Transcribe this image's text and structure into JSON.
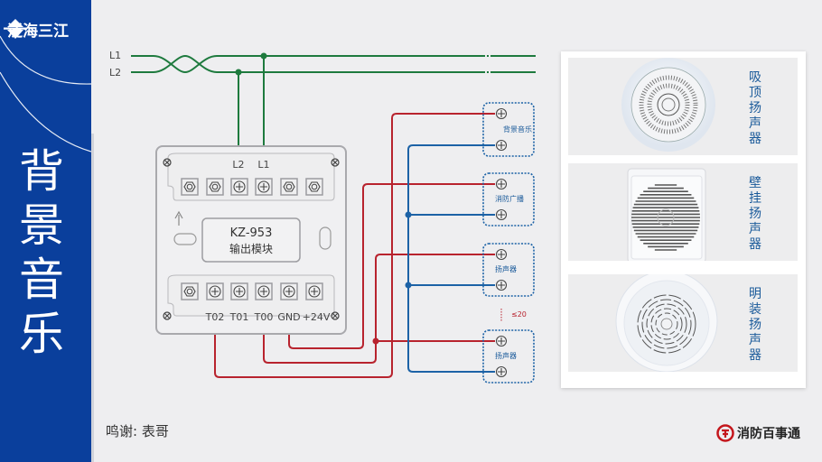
{
  "brand": {
    "name": "泛海三江",
    "logo_icon": "diamond-logo-icon"
  },
  "page_title": {
    "chars": [
      "背",
      "景",
      "音",
      "乐"
    ],
    "text": "背景音乐"
  },
  "colors": {
    "sidebar": "#0a3f9c",
    "power_line": "#1e7a3e",
    "signal_red": "#b8232e",
    "signal_blue": "#1c62a6",
    "speaker_box": "#1c62a6"
  },
  "power_lines": {
    "l1": "L1",
    "l2": "L2"
  },
  "module": {
    "model": "KZ-953",
    "name": "输出模块",
    "top_terminals": [
      "",
      "",
      "L2",
      "L1",
      "",
      ""
    ],
    "bottom_terminals": [
      "",
      "T02",
      "T01",
      "T00",
      "GND",
      "+24V"
    ]
  },
  "speakers": [
    {
      "label": "背景音乐"
    },
    {
      "label": "消防广播"
    },
    {
      "label": "扬声器"
    },
    {
      "label": "扬声器"
    }
  ],
  "spacing_note": "≤20",
  "products": [
    {
      "label_chars": [
        "吸",
        "顶",
        "扬",
        "声",
        "器"
      ],
      "label": "吸顶扬声器"
    },
    {
      "label_chars": [
        "壁",
        "挂",
        "扬",
        "声",
        "器"
      ],
      "label": "壁挂扬声器"
    },
    {
      "label_chars": [
        "明",
        "装",
        "扬",
        "声",
        "器"
      ],
      "label": "明装扬声器"
    }
  ],
  "credit": "鸣谢: 表哥",
  "footer_logo": {
    "name": "消防百事通"
  }
}
